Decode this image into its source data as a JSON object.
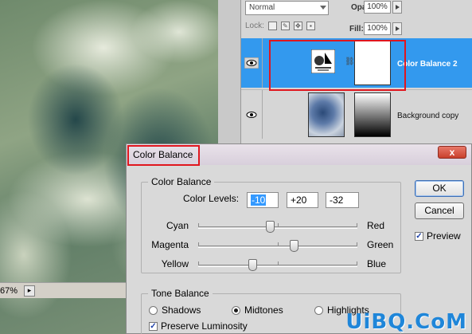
{
  "canvas": {
    "zoom_level": "67%"
  },
  "layers_panel": {
    "blend_mode": "Normal",
    "opacity_label": "Opacity:",
    "opacity_value": "100%",
    "lock_label": "Lock:",
    "fill_label": "Fill:",
    "fill_value": "100%",
    "layers": [
      {
        "name": "Color Balance 2",
        "selected": true,
        "visible": true
      },
      {
        "name": "Background copy",
        "selected": false,
        "visible": true
      }
    ]
  },
  "dialog": {
    "title": "Color Balance",
    "close_label": "x",
    "color_balance_group": "Color Balance",
    "color_levels_label": "Color Levels:",
    "color_levels": [
      "-10",
      "+20",
      "-32"
    ],
    "sliders": [
      {
        "left": "Cyan",
        "right": "Red",
        "value": -10
      },
      {
        "left": "Magenta",
        "right": "Green",
        "value": 20
      },
      {
        "left": "Yellow",
        "right": "Blue",
        "value": -32
      }
    ],
    "tone_balance_group": "Tone Balance",
    "tones": [
      {
        "label": "Shadows",
        "selected": false
      },
      {
        "label": "Midtones",
        "selected": true
      },
      {
        "label": "Highlights",
        "selected": false
      }
    ],
    "preserve_luminosity_label": "Preserve Luminosity",
    "preserve_luminosity_checked": true,
    "ok_label": "OK",
    "cancel_label": "Cancel",
    "preview_label": "Preview",
    "preview_checked": true
  },
  "watermark": "UiBQ.CoM",
  "colors": {
    "selection": "#3399ee",
    "highlight_box": "#e0161e",
    "watermark": "#1f86d9"
  }
}
